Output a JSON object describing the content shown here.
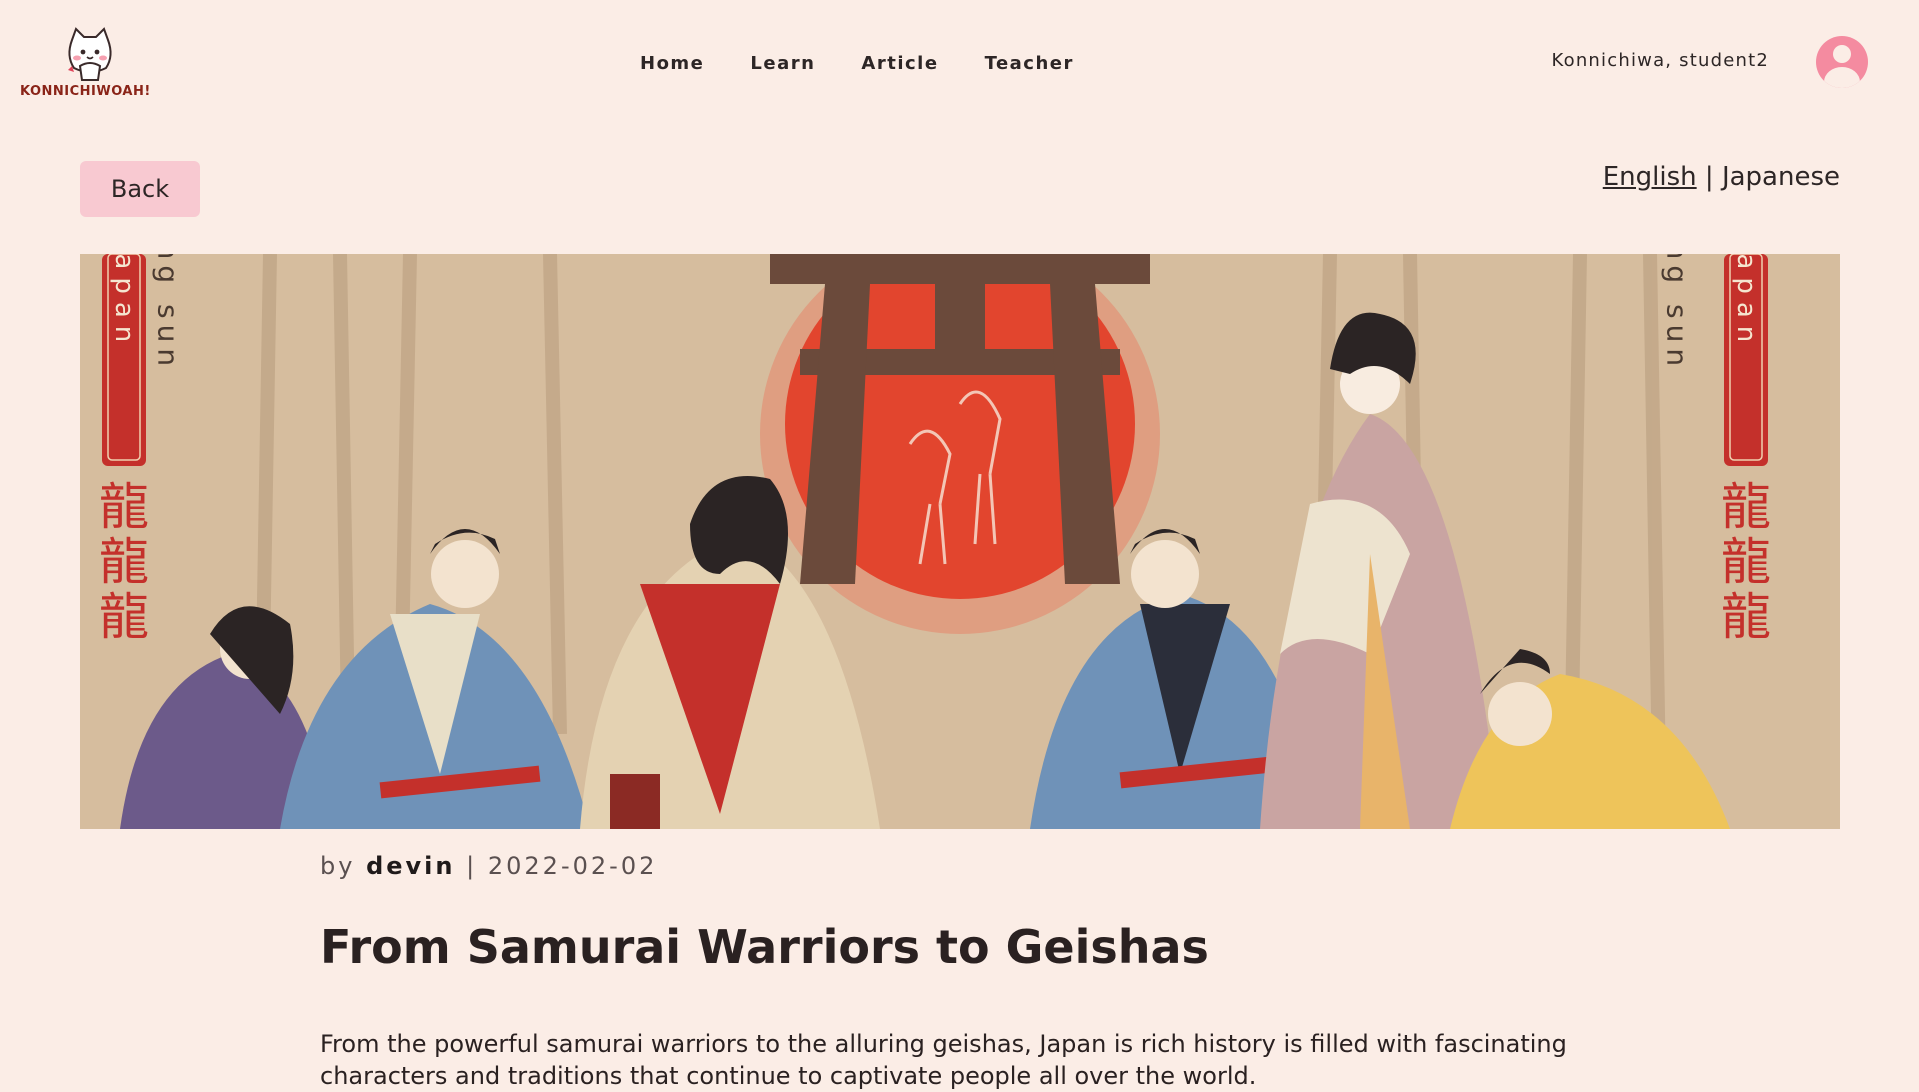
{
  "header": {
    "logo_text": "KONNICHIWOAH!",
    "nav": [
      "Home",
      "Learn",
      "Article",
      "Teacher"
    ],
    "greeting": "Konnichiwa, student2"
  },
  "toolbar": {
    "back_label": "Back",
    "lang_english": "English",
    "lang_separator": "|",
    "lang_japanese": "Japanese"
  },
  "banner": {
    "left_vertical_text": "Japan",
    "left_sub_text": "rising sun",
    "right_vertical_text": "Japan",
    "right_sub_text": "rising sun",
    "kanji": "龍",
    "colors": {
      "background": "#d6bd9e",
      "sun": "#e2452e",
      "torii": "#6b4a3b",
      "red_panel": "#c4302b"
    }
  },
  "article": {
    "by": "by",
    "author": "devin",
    "separator": "|",
    "date": "2022-02-02",
    "title": "From Samurai Warriors to Geishas",
    "body": "From the powerful samurai warriors to the alluring geishas, Japan is rich history is filled with fascinating characters and traditions that continue to captivate people all over the world."
  },
  "colors": {
    "page_background": "#fbede6",
    "back_button": "#f8c9d1",
    "avatar": "#f48ba0",
    "logo_text": "#8a2418"
  }
}
